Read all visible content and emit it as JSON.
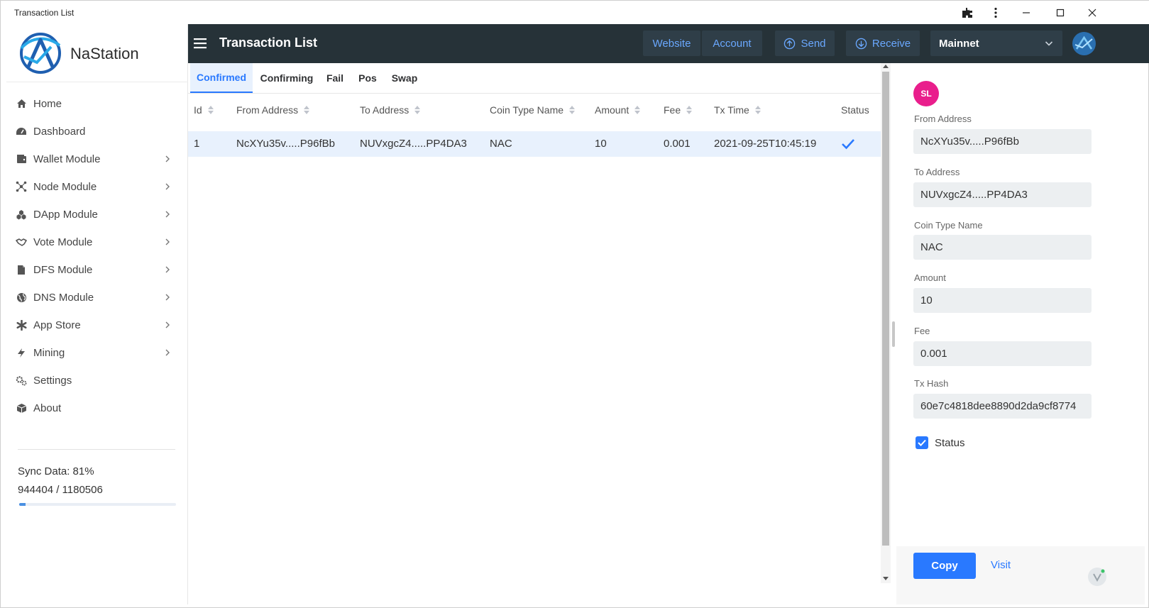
{
  "window": {
    "title": "Transaction List"
  },
  "brand": {
    "name": "NaStation"
  },
  "sidebar": {
    "items": [
      {
        "label": "Home",
        "icon": "home-icon",
        "has_submenu": false
      },
      {
        "label": "Dashboard",
        "icon": "dashboard-icon",
        "has_submenu": false
      },
      {
        "label": "Wallet Module",
        "icon": "wallet-icon",
        "has_submenu": true
      },
      {
        "label": "Node Module",
        "icon": "node-icon",
        "has_submenu": true
      },
      {
        "label": "DApp Module",
        "icon": "dapp-icon",
        "has_submenu": true
      },
      {
        "label": "Vote Module",
        "icon": "handshake-icon",
        "has_submenu": true
      },
      {
        "label": "DFS Module",
        "icon": "file-icon",
        "has_submenu": true
      },
      {
        "label": "DNS Module",
        "icon": "globe-icon",
        "has_submenu": true
      },
      {
        "label": "App Store",
        "icon": "asterisk-icon",
        "has_submenu": true
      },
      {
        "label": "Mining",
        "icon": "bolt-icon",
        "has_submenu": true
      },
      {
        "label": "Settings",
        "icon": "gears-icon",
        "has_submenu": false
      },
      {
        "label": "About",
        "icon": "box-icon",
        "has_submenu": false
      }
    ],
    "sync": {
      "label": "Sync Data: 81%",
      "count": "944404 / 1180506",
      "progress": 0.04
    }
  },
  "header": {
    "title": "Transaction List",
    "buttons": {
      "website": "Website",
      "account": "Account",
      "send": "Send",
      "receive": "Receive"
    },
    "network": "Mainnet"
  },
  "tabs": [
    {
      "label": "Confirmed",
      "active": true
    },
    {
      "label": "Confirming",
      "active": false
    },
    {
      "label": "Fail",
      "active": false
    },
    {
      "label": "Pos",
      "active": false
    },
    {
      "label": "Swap",
      "active": false
    }
  ],
  "table": {
    "columns": [
      "Id",
      "From Address",
      "To Address",
      "Coin Type Name",
      "Amount",
      "Fee",
      "Tx Time",
      "Status"
    ],
    "rows": [
      {
        "id": "1",
        "from": "NcXYu35v.....P96fBb",
        "to": "NUVxgcZ4.....PP4DA3",
        "coin": "NAC",
        "amount": "10",
        "fee": "0.001",
        "time": "2021-09-25T10:45:19",
        "status": "confirmed"
      }
    ]
  },
  "details": {
    "avatar": "SL",
    "fields": {
      "from_label": "From Address",
      "from_value": "NcXYu35v.....P96fBb",
      "to_label": "To Address",
      "to_value": "NUVxgcZ4.....PP4DA3",
      "coin_label": "Coin Type Name",
      "coin_value": "NAC",
      "amount_label": "Amount",
      "amount_value": "10",
      "fee_label": "Fee",
      "fee_value": "0.001",
      "hash_label": "Tx Hash",
      "hash_value": "60e7c4818dee8890d2da9cf8774"
    },
    "status_label": "Status",
    "status_checked": true,
    "copy_label": "Copy",
    "visit_label": "Visit"
  },
  "colors": {
    "header_bg": "#263238",
    "accent": "#2979ff",
    "avatar": "#e91e8c",
    "selected_row": "#e8f1fd"
  }
}
